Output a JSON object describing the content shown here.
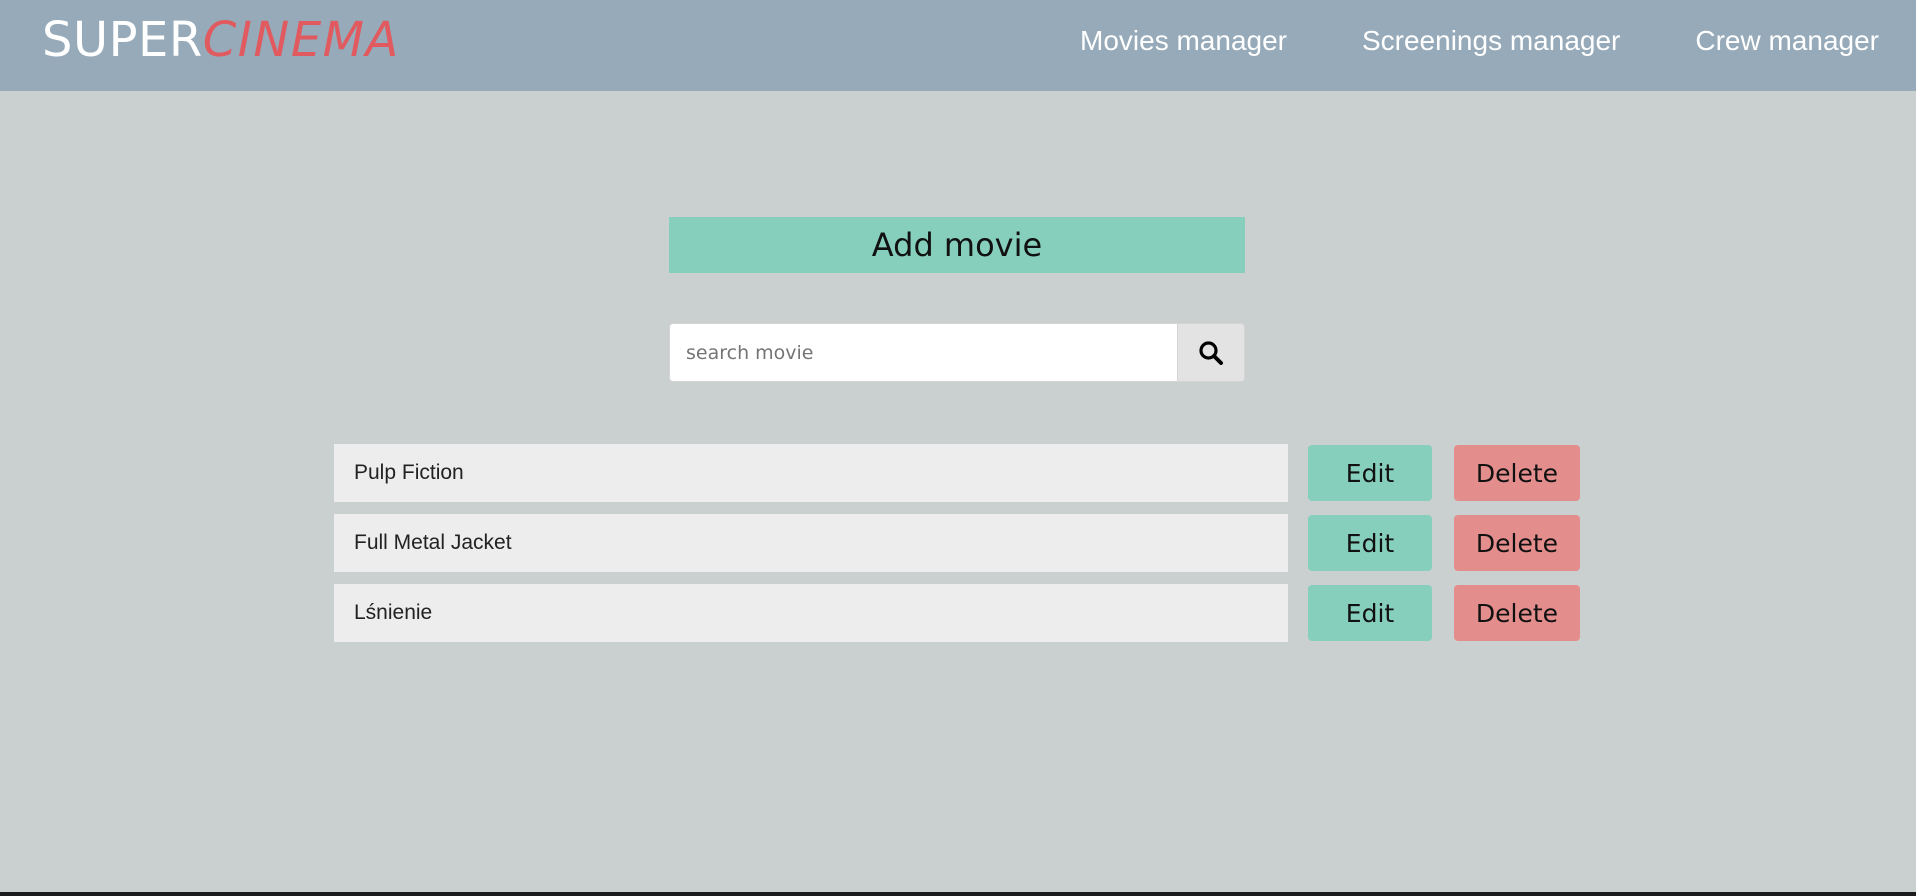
{
  "brand": {
    "part1": "SUPER",
    "part2": "CINEMA",
    "part1_color": "#ffffff",
    "part2_color": "#e05a5f"
  },
  "nav": {
    "items": [
      {
        "label": "Movies manager"
      },
      {
        "label": "Screenings manager"
      },
      {
        "label": "Crew manager"
      }
    ]
  },
  "main": {
    "add_movie_label": "Add movie",
    "search": {
      "placeholder": "search movie",
      "value": "",
      "icon": "search-icon"
    },
    "movies": [
      {
        "title": "Pulp Fiction",
        "edit_label": "Edit",
        "delete_label": "Delete"
      },
      {
        "title": "Full Metal Jacket",
        "edit_label": "Edit",
        "delete_label": "Delete"
      },
      {
        "title": "Lśnienie",
        "edit_label": "Edit",
        "delete_label": "Delete"
      }
    ]
  },
  "colors": {
    "navbar": "#96aab9",
    "background": "#cad0d0",
    "accent_green": "#87cfbd",
    "accent_red": "#e38d8d"
  }
}
